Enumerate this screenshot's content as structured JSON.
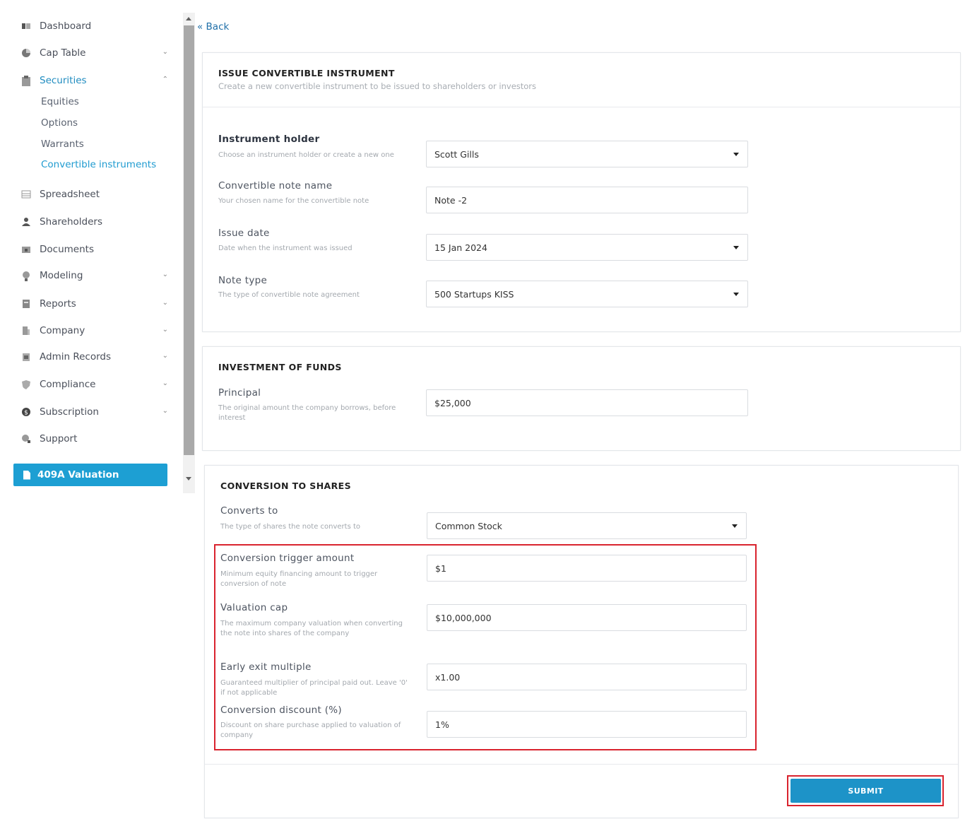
{
  "sidebar": {
    "items": [
      {
        "label": "Dashboard",
        "icon": "dashboard-icon"
      },
      {
        "label": "Cap Table",
        "icon": "pie-chart-icon"
      },
      {
        "label": "Securities",
        "icon": "clipboard-icon"
      },
      {
        "label": "Spreadsheet",
        "icon": "table-icon"
      },
      {
        "label": "Shareholders",
        "icon": "person-icon"
      },
      {
        "label": "Documents",
        "icon": "folder-icon"
      },
      {
        "label": "Modeling",
        "icon": "lightbulb-icon"
      },
      {
        "label": "Reports",
        "icon": "report-icon"
      },
      {
        "label": "Company",
        "icon": "building-icon"
      },
      {
        "label": "Admin Records",
        "icon": "records-icon"
      },
      {
        "label": "Compliance",
        "icon": "shield-icon"
      },
      {
        "label": "Subscription",
        "icon": "dollar-icon"
      },
      {
        "label": "Support",
        "icon": "support-icon"
      }
    ],
    "securities_sub": [
      "Equities",
      "Options",
      "Warrants",
      "Convertible instruments"
    ],
    "valuation_label": "409A Valuation",
    "accent_color": "#1d9fd3"
  },
  "back_label": "« Back",
  "issue": {
    "title": "ISSUE CONVERTIBLE INSTRUMENT",
    "subtitle": "Create a new convertible instrument to be issued to shareholders or investors",
    "holder_label": "Instrument holder",
    "holder_help": "Choose an instrument holder or create a new one",
    "holder_value": "Scott Gills",
    "name_label": "Convertible note name",
    "name_help": "Your chosen name for the convertible note",
    "name_value": "Note -2",
    "date_label": "Issue date",
    "date_help": "Date when the instrument was issued",
    "date_value": "15 Jan 2024",
    "type_label": "Note type",
    "type_help": "The type of convertible note agreement",
    "type_value": "500 Startups KISS"
  },
  "investment": {
    "title": "INVESTMENT OF FUNDS",
    "principal_label": "Principal",
    "principal_help": "The original amount the company borrows, before interest",
    "principal_value": "$25,000"
  },
  "conversion": {
    "title": "CONVERSION TO SHARES",
    "converts_label": "Converts to",
    "converts_help": "The type of shares the note converts to",
    "converts_value": "Common Stock",
    "trigger_label": "Conversion trigger amount",
    "trigger_help": "Minimum equity financing amount to trigger conversion of note",
    "trigger_value": "$1",
    "cap_label": "Valuation cap",
    "cap_help": "The maximum company valuation when converting the note into shares of the company",
    "cap_value": "$10,000,000",
    "exit_label": "Early exit multiple",
    "exit_help": "Guaranteed multiplier of principal paid out. Leave '0' if not applicable",
    "exit_value": "x1.00",
    "discount_label": "Conversion discount (%)",
    "discount_help": "Discount on share purchase applied to valuation of company",
    "discount_value": "1%"
  },
  "submit_label": "SUBMIT",
  "highlight_color": "#d9232e"
}
